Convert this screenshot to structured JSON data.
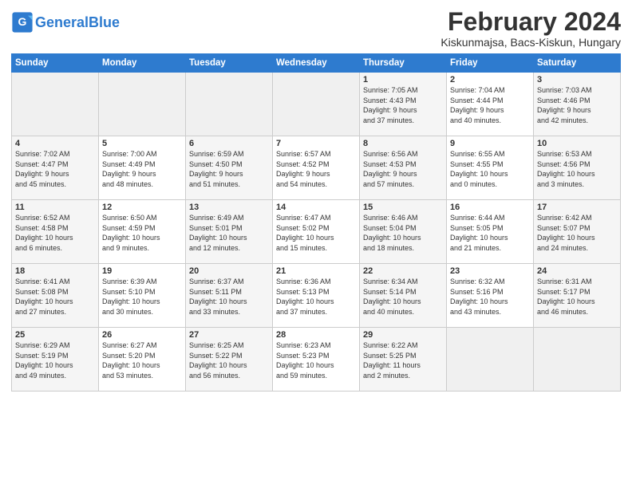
{
  "header": {
    "logo_general": "General",
    "logo_blue": "Blue",
    "month_title": "February 2024",
    "location": "Kiskunmajsa, Bacs-Kiskun, Hungary"
  },
  "days_of_week": [
    "Sunday",
    "Monday",
    "Tuesday",
    "Wednesday",
    "Thursday",
    "Friday",
    "Saturday"
  ],
  "weeks": [
    [
      {
        "day": "",
        "info": ""
      },
      {
        "day": "",
        "info": ""
      },
      {
        "day": "",
        "info": ""
      },
      {
        "day": "",
        "info": ""
      },
      {
        "day": "1",
        "info": "Sunrise: 7:05 AM\nSunset: 4:43 PM\nDaylight: 9 hours\nand 37 minutes."
      },
      {
        "day": "2",
        "info": "Sunrise: 7:04 AM\nSunset: 4:44 PM\nDaylight: 9 hours\nand 40 minutes."
      },
      {
        "day": "3",
        "info": "Sunrise: 7:03 AM\nSunset: 4:46 PM\nDaylight: 9 hours\nand 42 minutes."
      }
    ],
    [
      {
        "day": "4",
        "info": "Sunrise: 7:02 AM\nSunset: 4:47 PM\nDaylight: 9 hours\nand 45 minutes."
      },
      {
        "day": "5",
        "info": "Sunrise: 7:00 AM\nSunset: 4:49 PM\nDaylight: 9 hours\nand 48 minutes."
      },
      {
        "day": "6",
        "info": "Sunrise: 6:59 AM\nSunset: 4:50 PM\nDaylight: 9 hours\nand 51 minutes."
      },
      {
        "day": "7",
        "info": "Sunrise: 6:57 AM\nSunset: 4:52 PM\nDaylight: 9 hours\nand 54 minutes."
      },
      {
        "day": "8",
        "info": "Sunrise: 6:56 AM\nSunset: 4:53 PM\nDaylight: 9 hours\nand 57 minutes."
      },
      {
        "day": "9",
        "info": "Sunrise: 6:55 AM\nSunset: 4:55 PM\nDaylight: 10 hours\nand 0 minutes."
      },
      {
        "day": "10",
        "info": "Sunrise: 6:53 AM\nSunset: 4:56 PM\nDaylight: 10 hours\nand 3 minutes."
      }
    ],
    [
      {
        "day": "11",
        "info": "Sunrise: 6:52 AM\nSunset: 4:58 PM\nDaylight: 10 hours\nand 6 minutes."
      },
      {
        "day": "12",
        "info": "Sunrise: 6:50 AM\nSunset: 4:59 PM\nDaylight: 10 hours\nand 9 minutes."
      },
      {
        "day": "13",
        "info": "Sunrise: 6:49 AM\nSunset: 5:01 PM\nDaylight: 10 hours\nand 12 minutes."
      },
      {
        "day": "14",
        "info": "Sunrise: 6:47 AM\nSunset: 5:02 PM\nDaylight: 10 hours\nand 15 minutes."
      },
      {
        "day": "15",
        "info": "Sunrise: 6:46 AM\nSunset: 5:04 PM\nDaylight: 10 hours\nand 18 minutes."
      },
      {
        "day": "16",
        "info": "Sunrise: 6:44 AM\nSunset: 5:05 PM\nDaylight: 10 hours\nand 21 minutes."
      },
      {
        "day": "17",
        "info": "Sunrise: 6:42 AM\nSunset: 5:07 PM\nDaylight: 10 hours\nand 24 minutes."
      }
    ],
    [
      {
        "day": "18",
        "info": "Sunrise: 6:41 AM\nSunset: 5:08 PM\nDaylight: 10 hours\nand 27 minutes."
      },
      {
        "day": "19",
        "info": "Sunrise: 6:39 AM\nSunset: 5:10 PM\nDaylight: 10 hours\nand 30 minutes."
      },
      {
        "day": "20",
        "info": "Sunrise: 6:37 AM\nSunset: 5:11 PM\nDaylight: 10 hours\nand 33 minutes."
      },
      {
        "day": "21",
        "info": "Sunrise: 6:36 AM\nSunset: 5:13 PM\nDaylight: 10 hours\nand 37 minutes."
      },
      {
        "day": "22",
        "info": "Sunrise: 6:34 AM\nSunset: 5:14 PM\nDaylight: 10 hours\nand 40 minutes."
      },
      {
        "day": "23",
        "info": "Sunrise: 6:32 AM\nSunset: 5:16 PM\nDaylight: 10 hours\nand 43 minutes."
      },
      {
        "day": "24",
        "info": "Sunrise: 6:31 AM\nSunset: 5:17 PM\nDaylight: 10 hours\nand 46 minutes."
      }
    ],
    [
      {
        "day": "25",
        "info": "Sunrise: 6:29 AM\nSunset: 5:19 PM\nDaylight: 10 hours\nand 49 minutes."
      },
      {
        "day": "26",
        "info": "Sunrise: 6:27 AM\nSunset: 5:20 PM\nDaylight: 10 hours\nand 53 minutes."
      },
      {
        "day": "27",
        "info": "Sunrise: 6:25 AM\nSunset: 5:22 PM\nDaylight: 10 hours\nand 56 minutes."
      },
      {
        "day": "28",
        "info": "Sunrise: 6:23 AM\nSunset: 5:23 PM\nDaylight: 10 hours\nand 59 minutes."
      },
      {
        "day": "29",
        "info": "Sunrise: 6:22 AM\nSunset: 5:25 PM\nDaylight: 11 hours\nand 2 minutes."
      },
      {
        "day": "",
        "info": ""
      },
      {
        "day": "",
        "info": ""
      }
    ]
  ]
}
